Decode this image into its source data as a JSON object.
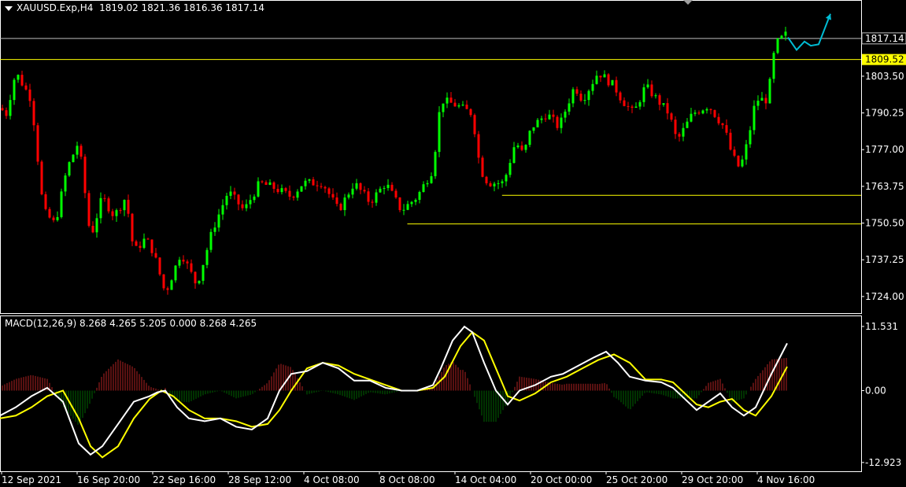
{
  "header": {
    "symbol": "XAUUSD.Exp,H4",
    "ohlc": "1819.02 1821.36 1816.36 1817.14"
  },
  "macd": {
    "label": "MACD(12,26,9) 8.268 4.265 5.205 0.000 8.268 4.265"
  },
  "colors": {
    "background": "#000000",
    "bull": "#00ff00",
    "bear": "#ff0000",
    "level": "#ffff00",
    "bid": "#c0c0c0",
    "macd_line": "#ffffff",
    "signal_line": "#ffff00",
    "hist_pos": "#b22222",
    "hist_neg": "#006400",
    "forecast": "#00bcd4"
  },
  "chart_data": [
    {
      "type": "candlestick",
      "name": "price",
      "ylim": [
        1718,
        1831
      ],
      "y_ticks": [
        "1817.14",
        "1803.50",
        "1790.25",
        "1777.00",
        "1763.75",
        "1750.50",
        "1737.25",
        "1724.00"
      ],
      "y_tick_values": [
        1817.14,
        1803.5,
        1790.25,
        1777.0,
        1763.75,
        1750.5,
        1737.25,
        1724.0
      ],
      "x_ticks": [
        "12 Sep 2021",
        "16 Sep 20:00",
        "22 Sep 16:00",
        "28 Sep 12:00",
        "4 Oct 08:00",
        "8 Oct 08:00",
        "14 Oct 04:00",
        "20 Oct 00:00",
        "25 Oct 20:00",
        "29 Oct 20:00",
        "4 Nov 16:00"
      ],
      "current_price": 1817.14,
      "current_price_label": "1817.14",
      "resistance_label": "1809.52",
      "levels": [
        {
          "value": 1809.52,
          "from": 0,
          "to": 1
        },
        {
          "value": 1760.5,
          "from": 0.583,
          "to": 1
        },
        {
          "value": 1750.2,
          "from": 0.473,
          "to": 1
        }
      ],
      "anchors": [
        [
          0,
          1792
        ],
        [
          8,
          1790
        ],
        [
          20,
          1805
        ],
        [
          40,
          1795
        ],
        [
          55,
          1755
        ],
        [
          70,
          1750
        ],
        [
          85,
          1770
        ],
        [
          100,
          1780
        ],
        [
          115,
          1745
        ],
        [
          130,
          1760
        ],
        [
          145,
          1753
        ],
        [
          160,
          1760
        ],
        [
          170,
          1740
        ],
        [
          185,
          1745
        ],
        [
          195,
          1740
        ],
        [
          210,
          1725
        ],
        [
          230,
          1740
        ],
        [
          250,
          1728
        ],
        [
          270,
          1748
        ],
        [
          290,
          1762
        ],
        [
          310,
          1755
        ],
        [
          330,
          1765
        ],
        [
          350,
          1763
        ],
        [
          370,
          1760
        ],
        [
          385,
          1765
        ],
        [
          410,
          1765
        ],
        [
          430,
          1755
        ],
        [
          450,
          1765
        ],
        [
          470,
          1758
        ],
        [
          490,
          1765
        ],
        [
          510,
          1755
        ],
        [
          530,
          1760
        ],
        [
          550,
          1770
        ],
        [
          560,
          1795
        ],
        [
          580,
          1793
        ],
        [
          600,
          1790
        ],
        [
          610,
          1770
        ],
        [
          620,
          1765
        ],
        [
          640,
          1765
        ],
        [
          655,
          1780
        ],
        [
          665,
          1775
        ],
        [
          675,
          1785
        ],
        [
          695,
          1790
        ],
        [
          710,
          1785
        ],
        [
          730,
          1800
        ],
        [
          740,
          1795
        ],
        [
          760,
          1805
        ],
        [
          780,
          1800
        ],
        [
          790,
          1795
        ],
        [
          805,
          1790
        ],
        [
          820,
          1800
        ],
        [
          835,
          1795
        ],
        [
          850,
          1790
        ],
        [
          860,
          1780
        ],
        [
          880,
          1790
        ],
        [
          900,
          1793
        ],
        [
          920,
          1785
        ],
        [
          930,
          1775
        ],
        [
          940,
          1770
        ],
        [
          950,
          1780
        ],
        [
          960,
          1795
        ],
        [
          975,
          1795
        ],
        [
          985,
          1815
        ],
        [
          1000,
          1819
        ]
      ],
      "forecast": [
        [
          1001,
          1817.5
        ],
        [
          1012,
          1813
        ],
        [
          1022,
          1816
        ],
        [
          1030,
          1814.5
        ],
        [
          1040,
          1815
        ],
        [
          1055,
          1826
        ]
      ]
    },
    {
      "type": "macd",
      "name": "MACD(12,26,9)",
      "ylim": [
        -14.5,
        13.5
      ],
      "y_ticks": [
        "11.531",
        "0.00",
        "-12.923"
      ],
      "y_tick_values": [
        11.531,
        0.0,
        -12.923
      ],
      "macd_line": [
        [
          0,
          -4.5
        ],
        [
          20,
          -3
        ],
        [
          40,
          -1
        ],
        [
          60,
          0.5
        ],
        [
          80,
          -2
        ],
        [
          100,
          -9.5
        ],
        [
          115,
          -11.5
        ],
        [
          130,
          -10
        ],
        [
          150,
          -6
        ],
        [
          170,
          -2
        ],
        [
          190,
          -1
        ],
        [
          200,
          -0.3
        ],
        [
          210,
          0
        ],
        [
          225,
          -3
        ],
        [
          240,
          -5
        ],
        [
          260,
          -5.5
        ],
        [
          280,
          -5
        ],
        [
          300,
          -6.5
        ],
        [
          320,
          -7
        ],
        [
          340,
          -5
        ],
        [
          355,
          0
        ],
        [
          370,
          3
        ],
        [
          390,
          3.5
        ],
        [
          410,
          5
        ],
        [
          430,
          4
        ],
        [
          450,
          1.8
        ],
        [
          470,
          1.8
        ],
        [
          490,
          0.5
        ],
        [
          510,
          0
        ],
        [
          530,
          0
        ],
        [
          550,
          1
        ],
        [
          560,
          4
        ],
        [
          575,
          9
        ],
        [
          590,
          11.5
        ],
        [
          600,
          10.5
        ],
        [
          615,
          5
        ],
        [
          630,
          0
        ],
        [
          645,
          -2.5
        ],
        [
          660,
          0
        ],
        [
          680,
          1
        ],
        [
          700,
          2.5
        ],
        [
          715,
          3
        ],
        [
          735,
          4.5
        ],
        [
          755,
          6
        ],
        [
          770,
          7
        ],
        [
          785,
          5
        ],
        [
          800,
          2.5
        ],
        [
          820,
          1.8
        ],
        [
          840,
          1.5
        ],
        [
          855,
          0.5
        ],
        [
          870,
          -1.5
        ],
        [
          885,
          -3.5
        ],
        [
          900,
          -2
        ],
        [
          915,
          -0.5
        ],
        [
          930,
          -3
        ],
        [
          945,
          -4.5
        ],
        [
          960,
          -3
        ],
        [
          980,
          3
        ],
        [
          1000,
          8.5
        ]
      ],
      "signal_line": [
        [
          0,
          -5
        ],
        [
          20,
          -4.5
        ],
        [
          40,
          -3
        ],
        [
          60,
          -1
        ],
        [
          80,
          0
        ],
        [
          100,
          -5
        ],
        [
          115,
          -10
        ],
        [
          130,
          -12
        ],
        [
          150,
          -10
        ],
        [
          170,
          -5
        ],
        [
          190,
          -1.5
        ],
        [
          205,
          0
        ],
        [
          220,
          -1
        ],
        [
          240,
          -3.5
        ],
        [
          260,
          -5
        ],
        [
          280,
          -5
        ],
        [
          300,
          -5.5
        ],
        [
          320,
          -6.5
        ],
        [
          340,
          -6
        ],
        [
          355,
          -3.5
        ],
        [
          370,
          0
        ],
        [
          390,
          4
        ],
        [
          410,
          5
        ],
        [
          430,
          4.5
        ],
        [
          450,
          3
        ],
        [
          470,
          2
        ],
        [
          490,
          1
        ],
        [
          510,
          0
        ],
        [
          530,
          0
        ],
        [
          550,
          0.5
        ],
        [
          565,
          2.5
        ],
        [
          585,
          8
        ],
        [
          600,
          10.5
        ],
        [
          615,
          9
        ],
        [
          630,
          4
        ],
        [
          645,
          -1
        ],
        [
          660,
          -1.8
        ],
        [
          680,
          -0.5
        ],
        [
          700,
          1.5
        ],
        [
          720,
          2.5
        ],
        [
          740,
          4
        ],
        [
          760,
          5.5
        ],
        [
          780,
          6.5
        ],
        [
          800,
          5
        ],
        [
          820,
          2
        ],
        [
          840,
          2
        ],
        [
          855,
          1.5
        ],
        [
          870,
          -0.5
        ],
        [
          885,
          -2.5
        ],
        [
          900,
          -3
        ],
        [
          915,
          -2
        ],
        [
          930,
          -1.5
        ],
        [
          945,
          -3.5
        ],
        [
          960,
          -4.5
        ],
        [
          980,
          -1
        ],
        [
          1000,
          4.3
        ]
      ]
    }
  ]
}
